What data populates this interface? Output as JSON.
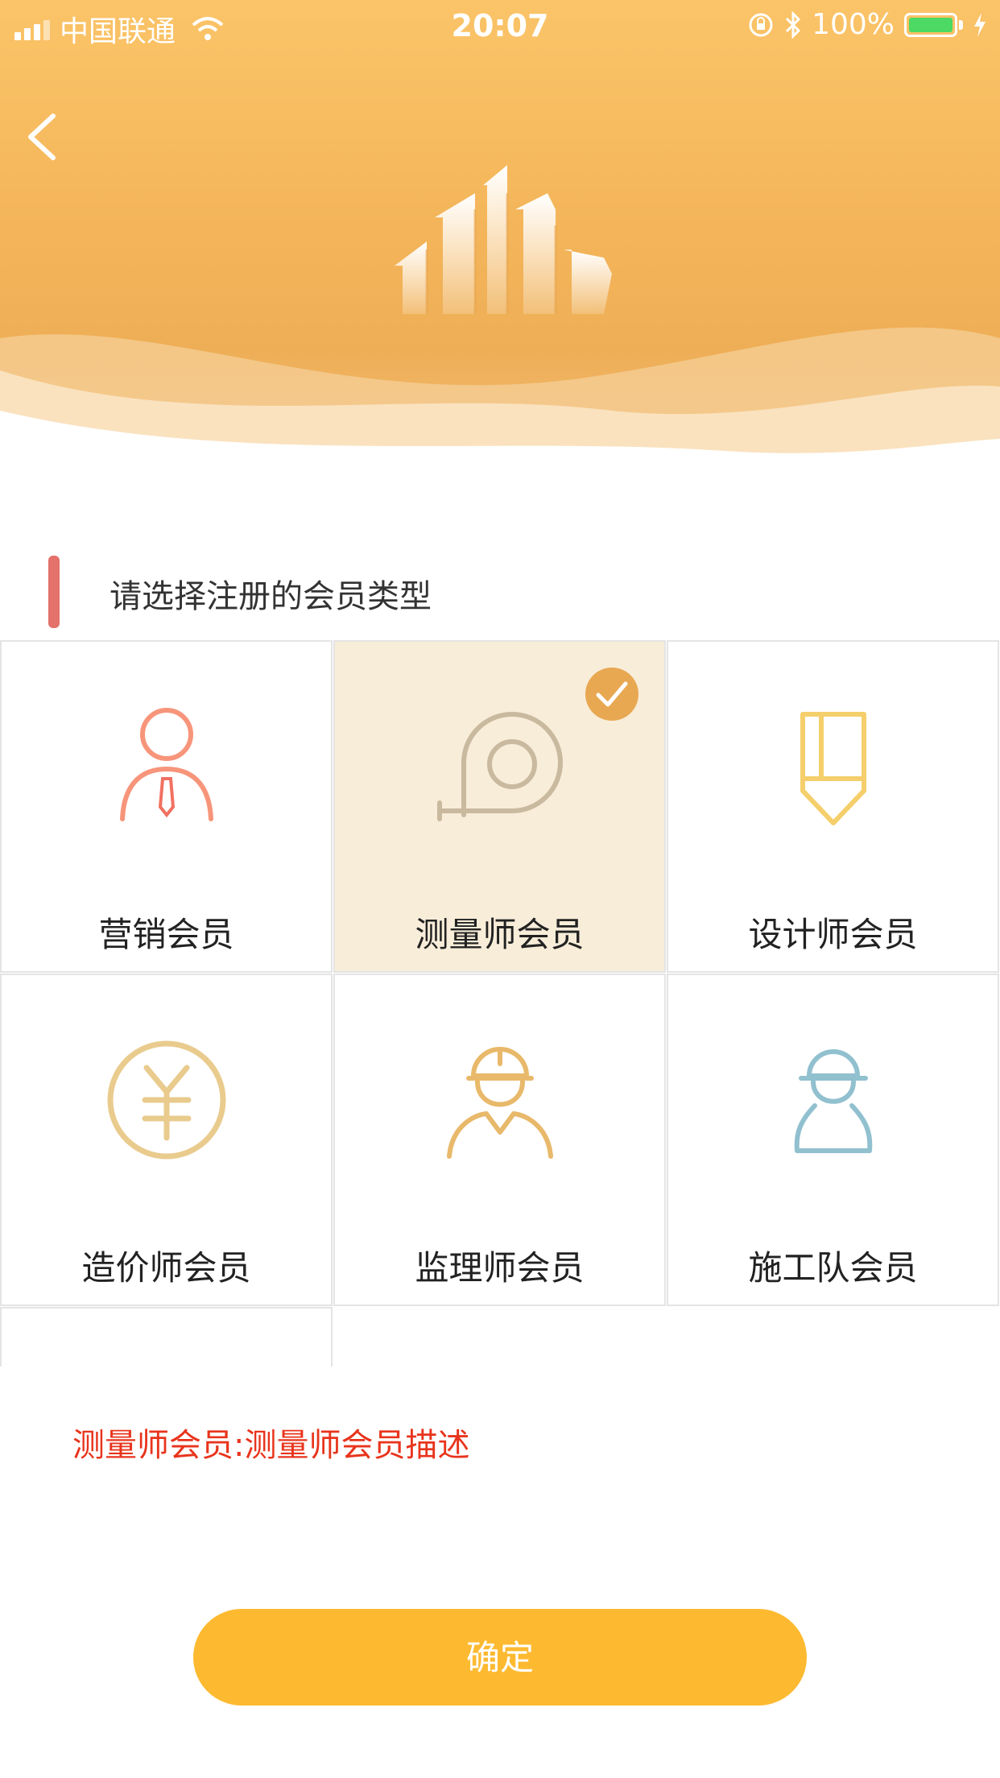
{
  "status_bar": {
    "carrier": "中国联通",
    "time": "20:07",
    "battery": "100%"
  },
  "header": {
    "back_icon": "chevron-left-icon",
    "logo_icon": "buildings-icon"
  },
  "section": {
    "title": "请选择注册的会员类型"
  },
  "member_types": [
    {
      "label": "营销会员",
      "icon": "salesman-icon",
      "selected": false
    },
    {
      "label": "测量师会员",
      "icon": "tape-measure-icon",
      "selected": true
    },
    {
      "label": "设计师会员",
      "icon": "pencil-icon",
      "selected": false
    },
    {
      "label": "造价师会员",
      "icon": "yuan-coin-icon",
      "selected": false
    },
    {
      "label": "监理师会员",
      "icon": "supervisor-helmet-icon",
      "selected": false
    },
    {
      "label": "施工队会员",
      "icon": "construction-worker-icon",
      "selected": false
    }
  ],
  "description": "测量师会员:测量师会员描述",
  "confirm_button": "确定",
  "colors": {
    "accent": "#fdba31",
    "header": "#f4b55a",
    "selected_bg": "#f8edd9",
    "description": "#e8341c",
    "section_bar": "#e4716a"
  }
}
